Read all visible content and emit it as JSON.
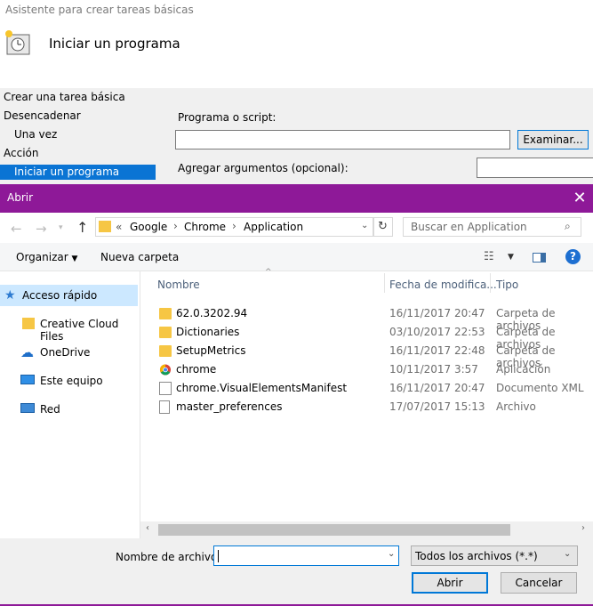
{
  "wizard": {
    "title": "Asistente para crear tareas básicas",
    "heading": "Iniciar un programa",
    "nav": [
      "Crear una tarea básica",
      "Desencadenar",
      "Una vez",
      "Acción",
      "Iniciar un programa"
    ],
    "program_label": "Programa o script:",
    "browse_label": "Examinar...",
    "args_label": "Agregar argumentos (opcional):"
  },
  "dialog": {
    "title": "Abrir",
    "close_glyph": "✕",
    "breadcrumb": {
      "prefix": "«",
      "parts": [
        "Google",
        "Chrome",
        "Application"
      ]
    },
    "search_placeholder": "Buscar en Application",
    "organize_label": "Organizar",
    "new_folder_label": "Nueva carpeta",
    "left_pane": [
      "Acceso rápido",
      "Creative Cloud Files",
      "OneDrive",
      "Este equipo",
      "Red"
    ],
    "columns": [
      "Nombre",
      "Fecha de modifica...",
      "Tipo"
    ],
    "files": [
      {
        "name": "62.0.3202.94",
        "date": "16/11/2017 20:47",
        "type": "Carpeta de archivos",
        "icon": "folder-icon"
      },
      {
        "name": "Dictionaries",
        "date": "03/10/2017 22:53",
        "type": "Carpeta de archivos",
        "icon": "folder-icon"
      },
      {
        "name": "SetupMetrics",
        "date": "16/11/2017 22:48",
        "type": "Carpeta de archivos",
        "icon": "folder-icon"
      },
      {
        "name": "chrome",
        "date": "10/11/2017 3:57",
        "type": "Aplicación",
        "icon": "chrome-icon"
      },
      {
        "name": "chrome.VisualElementsManifest",
        "date": "16/11/2017 20:47",
        "type": "Documento XML",
        "icon": "xml-file-icon"
      },
      {
        "name": "master_preferences",
        "date": "17/07/2017 15:13",
        "type": "Archivo",
        "icon": "file-icon"
      }
    ],
    "filename_label": "Nombre de archivo:",
    "filename_value": "",
    "filetype_value": "Todos los archivos (*.*)",
    "open_label": "Abrir",
    "cancel_label": "Cancelar"
  },
  "colors": {
    "titlebar": "#8e1998",
    "accent": "#0078d7",
    "selection": "#cce8ff"
  }
}
